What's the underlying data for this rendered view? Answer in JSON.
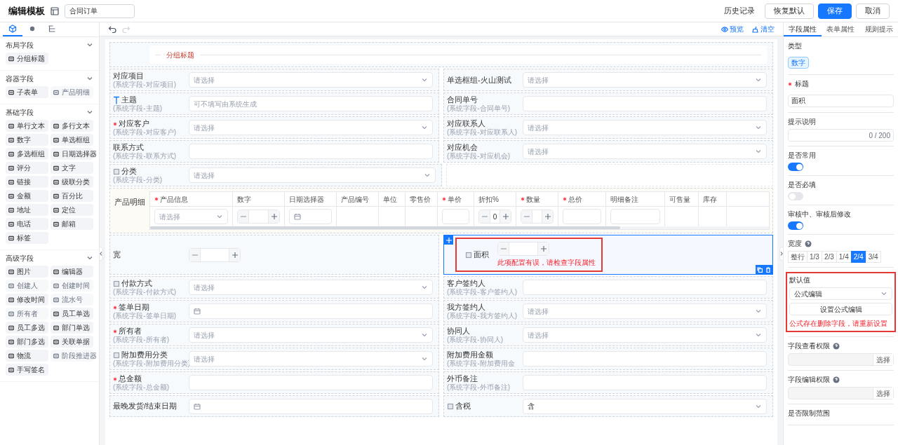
{
  "header": {
    "title": "编辑模板",
    "template_name": "合同订单",
    "history": "历史记录",
    "buttons": [
      {
        "label": "恢复默认",
        "kind": "default"
      },
      {
        "label": "保存",
        "kind": "primary"
      },
      {
        "label": "取消",
        "kind": "default"
      }
    ]
  },
  "left_panel": {
    "tabs": [
      {
        "kind": "components",
        "selected": true
      },
      {
        "kind": "help",
        "selected": false
      },
      {
        "kind": "outline",
        "selected": false
      }
    ],
    "groups": [
      {
        "title": "布局字段",
        "expanded": true,
        "items": [
          {
            "label": "分组标题",
            "disabled": false
          }
        ]
      },
      {
        "title": "容器字段",
        "expanded": true,
        "items": [
          {
            "label": "子表单",
            "disabled": false
          },
          {
            "label": "产品明细",
            "disabled": true
          }
        ]
      },
      {
        "title": "基础字段",
        "expanded": true,
        "items": [
          {
            "label": "单行文本",
            "disabled": false
          },
          {
            "label": "多行文本",
            "disabled": false
          },
          {
            "label": "数字",
            "disabled": false
          },
          {
            "label": "单选框组",
            "disabled": false
          },
          {
            "label": "多选框组",
            "disabled": false
          },
          {
            "label": "日期选择器",
            "disabled": false
          },
          {
            "label": "评分",
            "disabled": false
          },
          {
            "label": "文字",
            "disabled": false
          },
          {
            "label": "链接",
            "disabled": false
          },
          {
            "label": "级联分类",
            "disabled": false
          },
          {
            "label": "金额",
            "disabled": false
          },
          {
            "label": "百分比",
            "disabled": false
          },
          {
            "label": "地址",
            "disabled": false
          },
          {
            "label": "定位",
            "disabled": false
          },
          {
            "label": "电话",
            "disabled": false
          },
          {
            "label": "邮箱",
            "disabled": false
          },
          {
            "label": "标签",
            "disabled": false
          }
        ]
      },
      {
        "title": "高级字段",
        "expanded": true,
        "items": [
          {
            "label": "图片",
            "disabled": false
          },
          {
            "label": "编辑器",
            "disabled": false
          },
          {
            "label": "创建人",
            "disabled": true
          },
          {
            "label": "创建时间",
            "disabled": true
          },
          {
            "label": "修改时间",
            "disabled": false
          },
          {
            "label": "流水号",
            "disabled": true
          },
          {
            "label": "所有者",
            "disabled": true
          },
          {
            "label": "员工单选",
            "disabled": false
          },
          {
            "label": "员工多选",
            "disabled": false
          },
          {
            "label": "部门单选",
            "disabled": false
          },
          {
            "label": "部门多选",
            "disabled": false
          },
          {
            "label": "关联单据",
            "disabled": false
          },
          {
            "label": "物流",
            "disabled": false
          },
          {
            "label": "阶段推进器",
            "disabled": true
          },
          {
            "label": "手写签名",
            "disabled": false
          }
        ]
      }
    ]
  },
  "toolbar": {
    "actions": [
      {
        "label": "预览",
        "kind": "preview"
      },
      {
        "label": "清空",
        "kind": "clear"
      }
    ]
  },
  "form": {
    "sections": [
      {
        "kind": "group_title",
        "title": "分组标题"
      },
      {
        "kind": "pair",
        "cells": [
          {
            "label": "对应项目",
            "sub": "(系统字段-对应项目)",
            "required": false,
            "kind": "select",
            "placeholder": "请选择",
            "selected": false
          },
          {
            "label": "单选框组-火山测试",
            "required": false,
            "kind": "select",
            "placeholder": "请选择",
            "selected": false
          }
        ]
      },
      {
        "kind": "pair",
        "cells": [
          {
            "label": "主题",
            "sub": "(系统字段-主题)",
            "label_icon": {
              "kind": "text"
            },
            "required": false,
            "kind": "input",
            "placeholder": "可不填写由系统生成",
            "selected": false
          },
          {
            "label": "合同单号",
            "sub": "(系统字段-合同单号)",
            "required": false,
            "kind": "input",
            "selected": false
          }
        ]
      },
      {
        "kind": "pair",
        "cells": [
          {
            "label": "对应客户",
            "sub": "(系统字段-对应客户)",
            "required": true,
            "kind": "select",
            "placeholder": "请选择",
            "selected": false
          },
          {
            "label": "对应联系人",
            "sub": "(系统字段-对应联系人)",
            "required": false,
            "kind": "select",
            "placeholder": "请选择",
            "selected": false
          }
        ]
      },
      {
        "kind": "pair",
        "cells": [
          {
            "label": "联系方式",
            "sub": "(系统字段-联系方式)",
            "required": false,
            "kind": "input",
            "selected": false
          },
          {
            "label": "对应机会",
            "sub": "(系统字段-对应机会)",
            "required": false,
            "kind": "select",
            "placeholder": "请选择",
            "selected": false
          }
        ]
      },
      {
        "kind": "pair",
        "cells": [
          {
            "label": "分类",
            "sub": "(系统字段-分类)",
            "label_icon": {
              "kind": "box"
            },
            "required": false,
            "kind": "select",
            "placeholder": "请选择",
            "selected": false
          }
        ]
      },
      {
        "kind": "table",
        "label": "产品明细",
        "columns": [
          {
            "label": "产品信息",
            "required": true,
            "kind": "select",
            "placeholder": "请选择"
          },
          {
            "label": "数字",
            "required": false,
            "kind": "stepper"
          },
          {
            "label": "日期选择器",
            "required": false,
            "kind": "date"
          },
          {
            "label": "产品编号",
            "required": false,
            "kind": "empty"
          },
          {
            "label": "单位",
            "required": false,
            "kind": "empty"
          },
          {
            "label": "零售价",
            "required": false,
            "kind": "empty"
          },
          {
            "label": "单价",
            "required": true,
            "kind": "input"
          },
          {
            "label": "折扣%",
            "required": false,
            "kind": "stepper",
            "value": "0"
          },
          {
            "label": "数量",
            "required": true,
            "kind": "stepper"
          },
          {
            "label": "总价",
            "required": true,
            "kind": "input"
          },
          {
            "label": "明细备注",
            "required": false,
            "kind": "input"
          },
          {
            "label": "可售量",
            "required": false,
            "kind": "empty"
          },
          {
            "label": "库存",
            "required": false,
            "kind": "empty"
          }
        ]
      },
      {
        "kind": "pair",
        "cells": [
          {
            "label": "宽",
            "required": false,
            "kind": "stepper",
            "selected": false
          },
          {
            "label": "面积",
            "label_icon": {
              "kind": "box"
            },
            "required": false,
            "kind": "stepper",
            "selected": true,
            "error": "此项配置有误，请检查字段属性"
          }
        ]
      },
      {
        "kind": "pair",
        "cells": [
          {
            "label": "付款方式",
            "sub": "(系统字段-付款方式)",
            "label_icon": {
              "kind": "box"
            },
            "required": false,
            "kind": "select",
            "placeholder": "请选择",
            "selected": false
          },
          {
            "label": "客户签约人",
            "sub": "(系统字段-客户签约人)",
            "required": false,
            "kind": "input",
            "selected": false
          }
        ]
      },
      {
        "kind": "pair",
        "cells": [
          {
            "label": "签单日期",
            "sub": "(系统字段-签单日期)",
            "required": true,
            "kind": "date",
            "selected": false
          },
          {
            "label": "我方签约人",
            "sub": "(系统字段-我方签约人)",
            "required": false,
            "kind": "select",
            "placeholder": "请选择",
            "selected": false
          }
        ]
      },
      {
        "kind": "pair",
        "cells": [
          {
            "label": "所有者",
            "sub": "(系统字段-所有者)",
            "required": true,
            "kind": "select",
            "placeholder": "请选择",
            "selected": false
          },
          {
            "label": "协同人",
            "sub": "(系统字段-协同人)",
            "required": false,
            "kind": "select",
            "placeholder": "请选择",
            "selected": false
          }
        ]
      },
      {
        "kind": "pair",
        "cells": [
          {
            "label": "附加费用分类",
            "sub": "(系统字段-附加费用分类)",
            "label_icon": {
              "kind": "box"
            },
            "required": false,
            "kind": "select",
            "placeholder": "请选择",
            "selected": false
          },
          {
            "label": "附加费用金额",
            "sub": "(系统字段-附加费用金",
            "required": false,
            "kind": "input",
            "selected": false
          }
        ]
      },
      {
        "kind": "pair",
        "cells": [
          {
            "label": "总金额",
            "sub": "(系统字段-总金额)",
            "required": true,
            "kind": "input",
            "selected": false
          },
          {
            "label": "外币备注",
            "sub": "(系统字段-外币备注)",
            "required": false,
            "kind": "input",
            "selected": false
          }
        ]
      },
      {
        "kind": "pair",
        "cells": [
          {
            "label": "最晚发货/结束日期",
            "required": false,
            "kind": "date",
            "selected": false
          },
          {
            "label": "含税",
            "label_icon": {
              "kind": "box"
            },
            "required": false,
            "kind": "select",
            "value": "含",
            "selected": false
          }
        ]
      }
    ]
  },
  "right_panel": {
    "tabs": [
      {
        "label": "字段属性",
        "selected": true
      },
      {
        "label": "表单属性",
        "selected": false
      },
      {
        "label": "规则提示",
        "selected": false
      }
    ],
    "properties": [
      {
        "kind": "tag",
        "label": "类型",
        "required": false,
        "help": false,
        "value": "数字"
      },
      {
        "kind": "input",
        "label": "标题",
        "required": true,
        "help": false,
        "value": "面积"
      },
      {
        "kind": "textarea",
        "label": "提示说明",
        "required": false,
        "help": false,
        "counter": "0 / 200"
      },
      {
        "kind": "toggle",
        "label": "是否常用",
        "required": false,
        "help": false,
        "on": true
      },
      {
        "kind": "toggle",
        "label": "是否必填",
        "required": false,
        "help": false,
        "on": false
      },
      {
        "kind": "toggle",
        "label": "审核中、审核后修改",
        "required": false,
        "help": false,
        "on": true
      },
      {
        "kind": "segmented",
        "label": "宽度",
        "required": false,
        "help": true,
        "options": [
          {
            "label": "整行",
            "selected": false
          },
          {
            "label": "1/3",
            "selected": false
          },
          {
            "label": "2/3",
            "selected": false
          },
          {
            "label": "1/4",
            "selected": false
          },
          {
            "label": "2/4",
            "selected": true
          },
          {
            "label": "3/4",
            "selected": false
          }
        ]
      },
      {
        "kind": "default",
        "label": "默认值",
        "required": false,
        "help": false,
        "value": "公式编辑",
        "button": "设置公式编辑",
        "error": "公式存在删除字段，请重新设置"
      },
      {
        "kind": "picker",
        "label": "字段查看权限",
        "required": false,
        "help": true,
        "button": "选择"
      },
      {
        "kind": "picker",
        "label": "字段编辑权限",
        "required": false,
        "help": true,
        "button": "选择"
      },
      {
        "kind": "plain",
        "label": "是否限制范围",
        "required": false,
        "help": false
      }
    ]
  }
}
